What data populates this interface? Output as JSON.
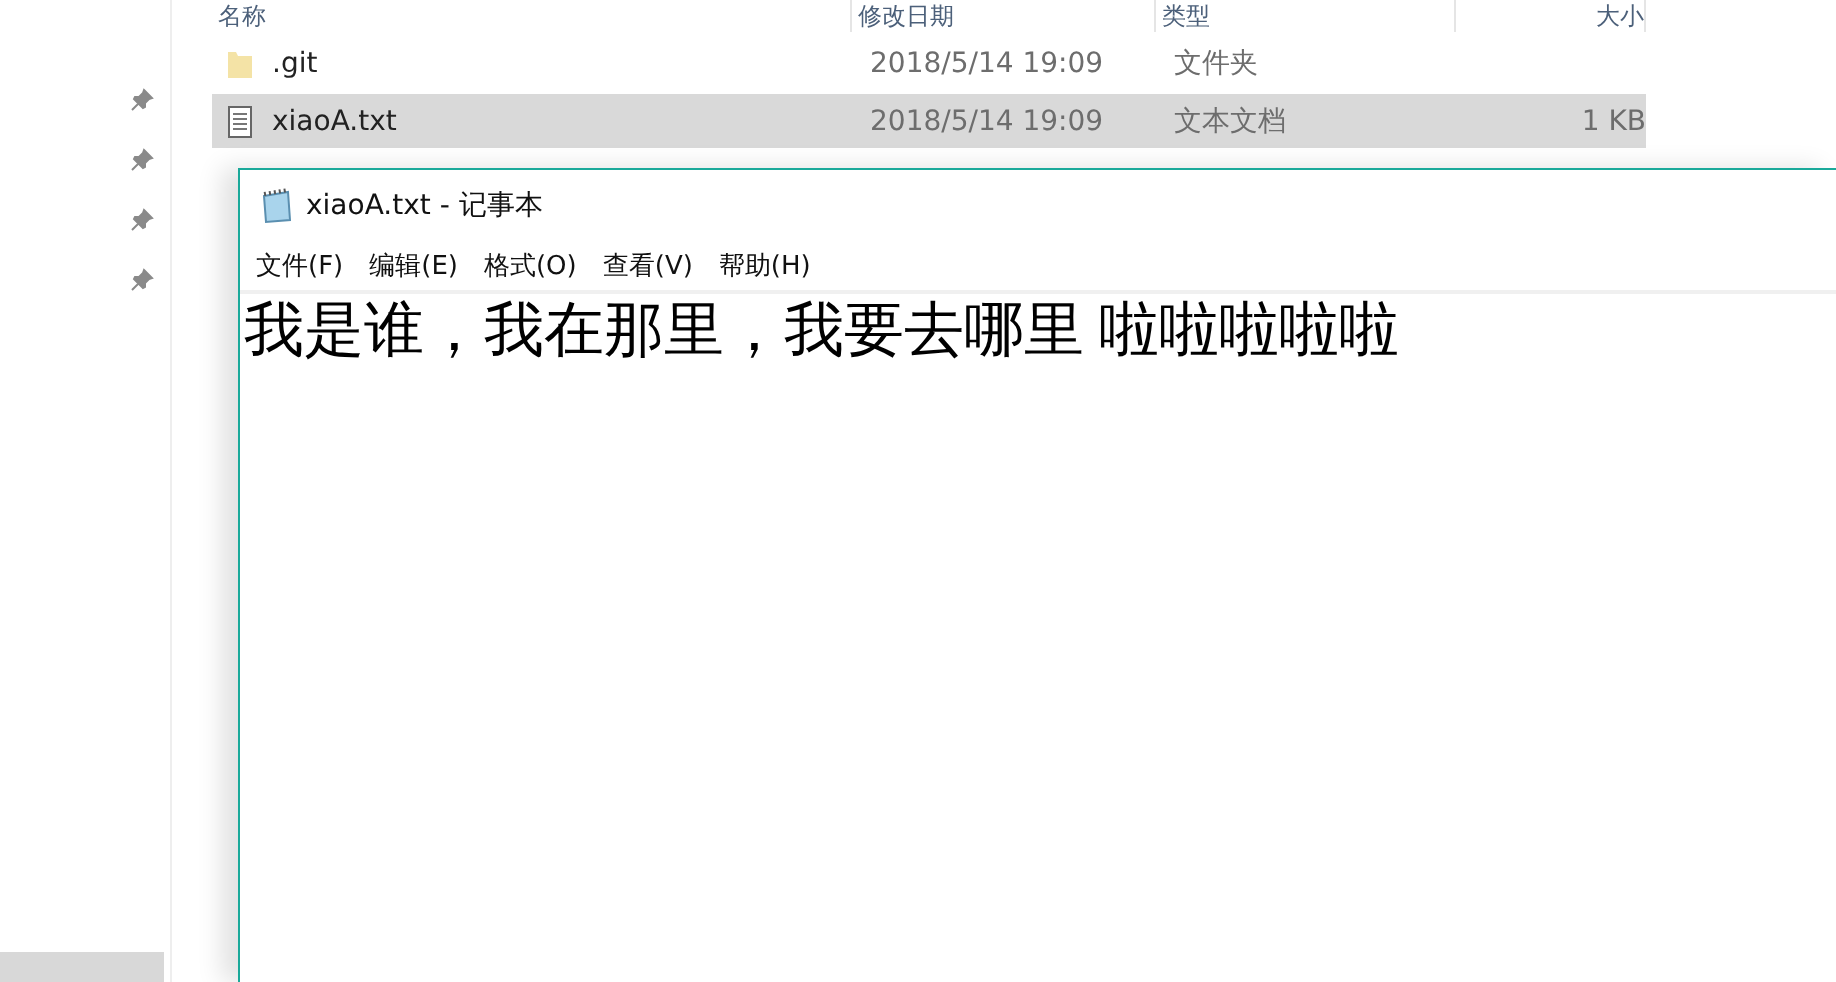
{
  "explorer": {
    "columns": [
      "名称",
      "修改日期",
      "类型",
      "大小"
    ],
    "rows": [
      {
        "kind": "folder",
        "name": ".git",
        "date": "2018/5/14 19:09",
        "type": "文件夹",
        "selected": false
      },
      {
        "kind": "file",
        "name": "xiaoA.txt",
        "date": "2018/5/14 19:09",
        "type": "文本文档",
        "size": "1 KB",
        "selected": true
      }
    ]
  },
  "notepad": {
    "title": "xiaoA.txt - 记事本",
    "menu": [
      "文件(F)",
      "编辑(E)",
      "格式(O)",
      "查看(V)",
      "帮助(H)"
    ],
    "text": "我是谁，我在那里，我要去哪里 啦啦啦啦啦"
  }
}
